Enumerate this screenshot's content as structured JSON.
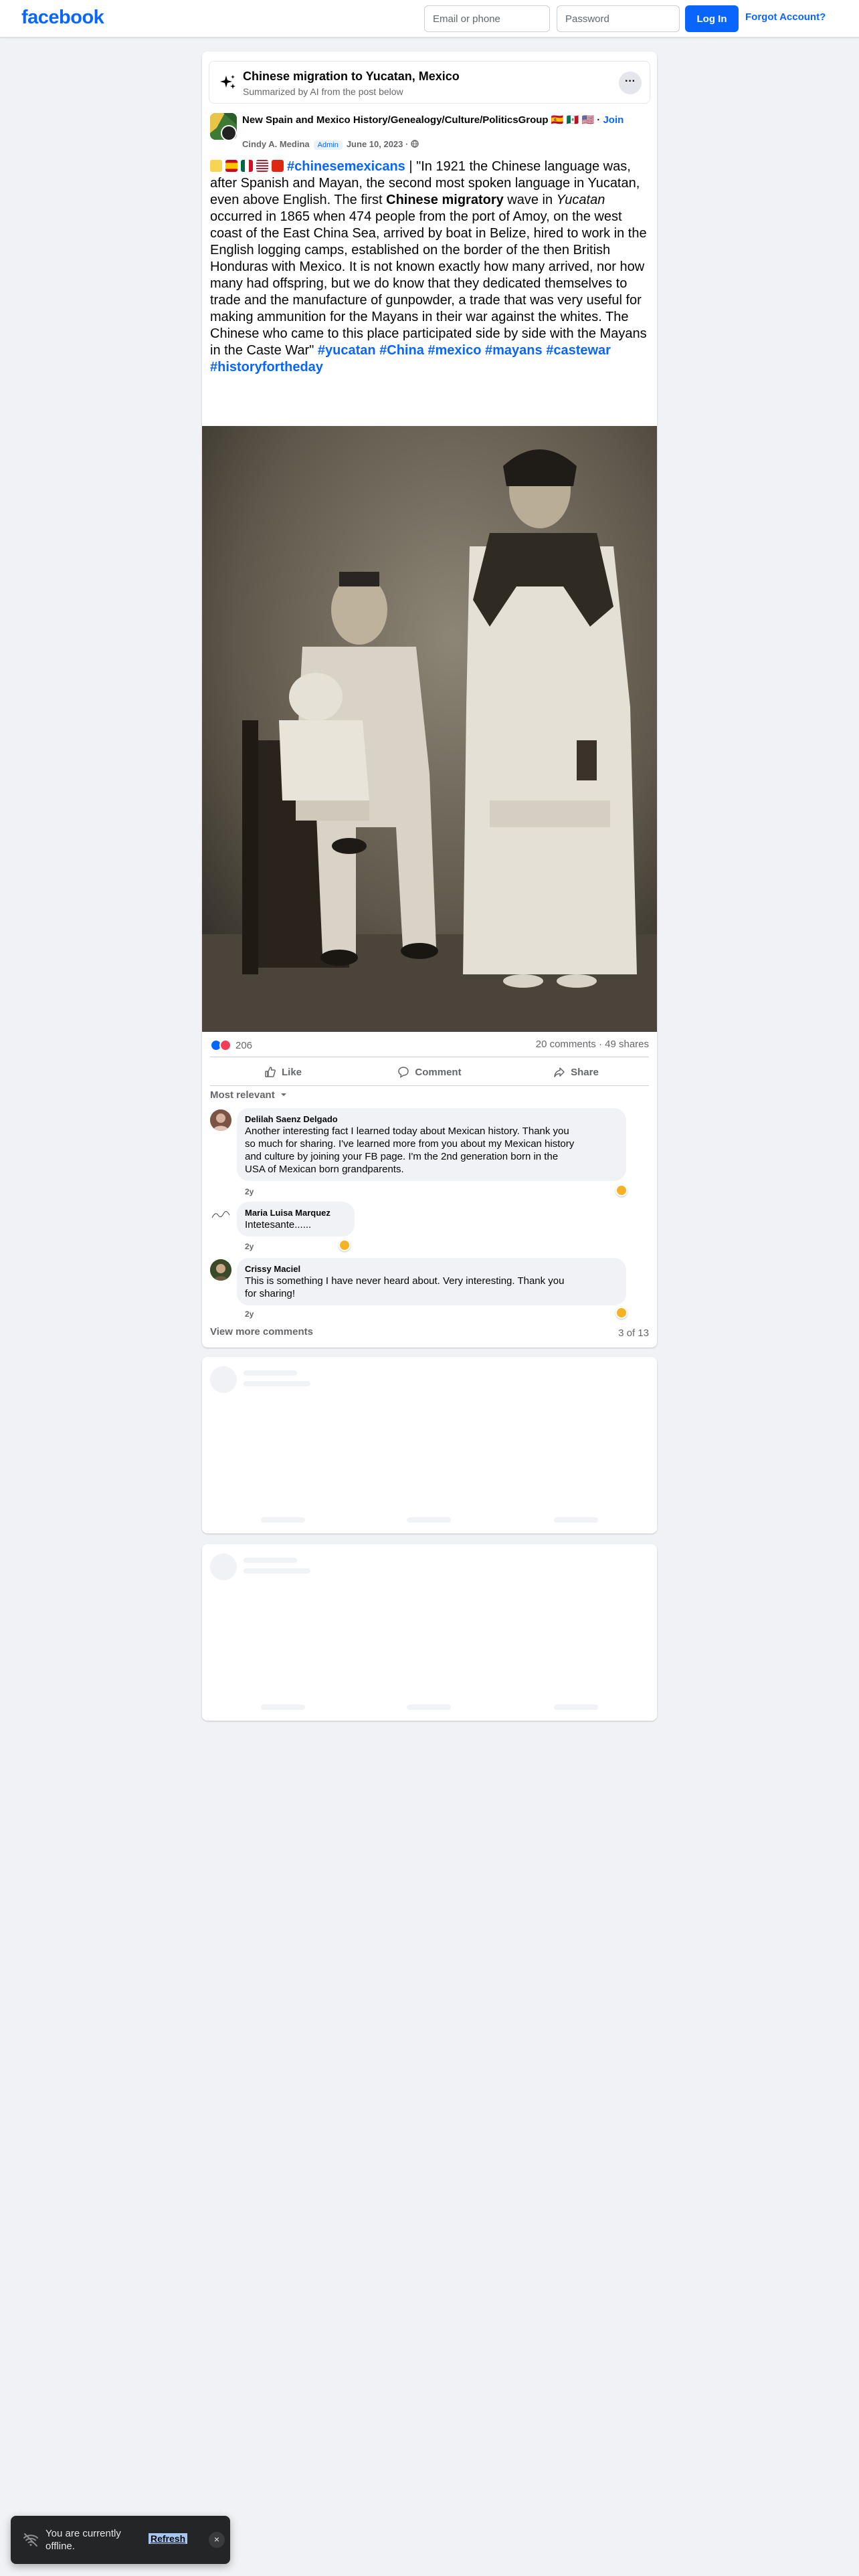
{
  "header": {
    "logo": "facebook",
    "email_placeholder": "Email or phone",
    "password_placeholder": "Password",
    "login_label": "Log In",
    "forgot_label": "Forgot Account?"
  },
  "ai_summary": {
    "title": "Chinese migration to Yucatan, Mexico",
    "subtitle": "Summarized by AI from the post below",
    "more_icon": "more-dots-icon"
  },
  "post": {
    "group_name": "New Spain and Mexico History/Genealogy/Culture/PoliticsGroup 🇪🇸 🇲🇽 🇺🇸",
    "join_label": "Join",
    "join_sep": " · ",
    "author": "Cindy A. Medina",
    "admin_badge": "Admin",
    "date": "June 10, 2023",
    "privacy_icon": "globe-icon",
    "hashtag_lead": "#chinesemexicans",
    "text_1": " | \"In 1921 the Chinese language was, after Spanish and Mayan, the second most spoken language in Yucatan, even above English. The first ",
    "bold_1": "Chinese migratory",
    "text_2": " wave in ",
    "italic_1": "Yucatan",
    "text_3": " occurred in 1865 when 474 people from the port of Amoy, on the west coast of the East China Sea, arrived by boat in Belize, hired to work in the English logging camps, established on the border of the then British Honduras with Mexico. It is not known exactly how many arrived, nor how many had offspring, but we do know that they dedicated themselves to trade and the manufacture of gunpowder, a trade that was very useful for making ammunition for the Mayans in their war against the whites. The Chinese who came to this place participated side by side with the Mayans in the Caste War\" ",
    "hashtags_tail": [
      "#yucatan",
      "#China",
      "#mexico",
      "#mayans",
      "#castewar",
      "#historyfortheday"
    ],
    "photo_alt": "Historical family portrait: a man in a white suit seated holding a child, a woman standing beside them"
  },
  "engagement": {
    "reaction_count": "206",
    "comments": "20 comments",
    "shares": "49 shares",
    "like_label": "Like",
    "comment_label": "Comment",
    "share_label": "Share",
    "sort_label": "Most relevant"
  },
  "comments": [
    {
      "name": "Delilah Saenz Delgado",
      "line1": "Another interesting fact I learned today about Mexican history. Thank you",
      "line2": "so much for sharing. I've learned more from you about my Mexican history",
      "line3": "and culture by joining your FB page. I'm the 2nd generation born in the",
      "line4": "USA of Mexican born grandparents.",
      "time": "2y"
    },
    {
      "name": "Maria Luisa Marquez",
      "line1": "Intetesante......",
      "time": "2y"
    },
    {
      "name": "Crissy Maciel",
      "line1": "This is something I have never heard about. Very interesting. Thank you",
      "line2": "for sharing!",
      "time": "2y"
    }
  ],
  "footer": {
    "view_more": "View more comments",
    "count": "3 of 13"
  },
  "toast": {
    "text": "You are currently offline.",
    "refresh": "Refresh",
    "close": "×"
  },
  "colors": {
    "brand": "#0866ff",
    "background": "#f0f2f5",
    "secondary_text": "#65676b"
  }
}
